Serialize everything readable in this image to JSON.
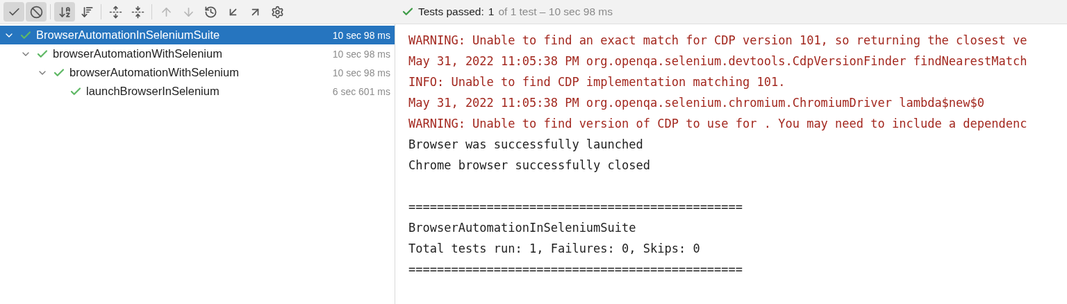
{
  "toolbar": {
    "groups": [
      [
        {
          "kind": "check",
          "pressed": true,
          "disabled": false
        },
        {
          "kind": "ban",
          "pressed": true,
          "disabled": false
        }
      ],
      [
        {
          "kind": "sort-alpha",
          "pressed": true,
          "disabled": false
        },
        {
          "kind": "sort-duration",
          "pressed": false,
          "disabled": false
        }
      ],
      [
        {
          "kind": "expand-all",
          "pressed": false,
          "disabled": false
        },
        {
          "kind": "collapse-all",
          "pressed": false,
          "disabled": false
        }
      ],
      [
        {
          "kind": "up",
          "pressed": false,
          "disabled": true
        },
        {
          "kind": "down",
          "pressed": false,
          "disabled": true
        },
        {
          "kind": "history",
          "pressed": false,
          "disabled": false
        },
        {
          "kind": "import",
          "pressed": false,
          "disabled": false
        },
        {
          "kind": "export",
          "pressed": false,
          "disabled": false
        },
        {
          "kind": "settings",
          "pressed": false,
          "disabled": false
        }
      ]
    ]
  },
  "status": {
    "label": "Tests passed:",
    "count": "1",
    "detail": "of 1 test – 10 sec 98 ms"
  },
  "tree": [
    {
      "name": "BrowserAutomationInSeleniumSuite",
      "time": "10 sec 98 ms",
      "selected": true,
      "expanded": true,
      "children": [
        {
          "name": "browserAutomationWithSelenium",
          "time": "10 sec 98 ms",
          "selected": false,
          "expanded": true,
          "children": [
            {
              "name": "browserAutomationWithSelenium",
              "time": "10 sec 98 ms",
              "selected": false,
              "expanded": true,
              "children": [
                {
                  "name": "launchBrowserInSelenium",
                  "time": "6 sec 601 ms",
                  "selected": false
                }
              ]
            }
          ]
        }
      ]
    }
  ],
  "console": [
    {
      "kind": "error",
      "text": "WARNING: Unable to find an exact match for CDP version 101, so returning the closest ve"
    },
    {
      "kind": "error",
      "text": "May 31, 2022 11:05:38 PM org.openqa.selenium.devtools.CdpVersionFinder findNearestMatch"
    },
    {
      "kind": "error",
      "text": "INFO: Unable to find CDP implementation matching 101."
    },
    {
      "kind": "error",
      "text": "May 31, 2022 11:05:38 PM org.openqa.selenium.chromium.ChromiumDriver lambda$new$0"
    },
    {
      "kind": "error",
      "text": "WARNING: Unable to find version of CDP to use for . You may need to include a dependenc"
    },
    {
      "kind": "output",
      "text": "Browser was successfully launched"
    },
    {
      "kind": "output",
      "text": "Chrome browser successfully closed"
    },
    {
      "kind": "blank"
    },
    {
      "kind": "output",
      "text": "==============================================="
    },
    {
      "kind": "output",
      "text": "BrowserAutomationInSeleniumSuite"
    },
    {
      "kind": "output",
      "text": "Total tests run: 1, Failures: 0, Skips: 0"
    },
    {
      "kind": "output",
      "text": "==============================================="
    }
  ]
}
